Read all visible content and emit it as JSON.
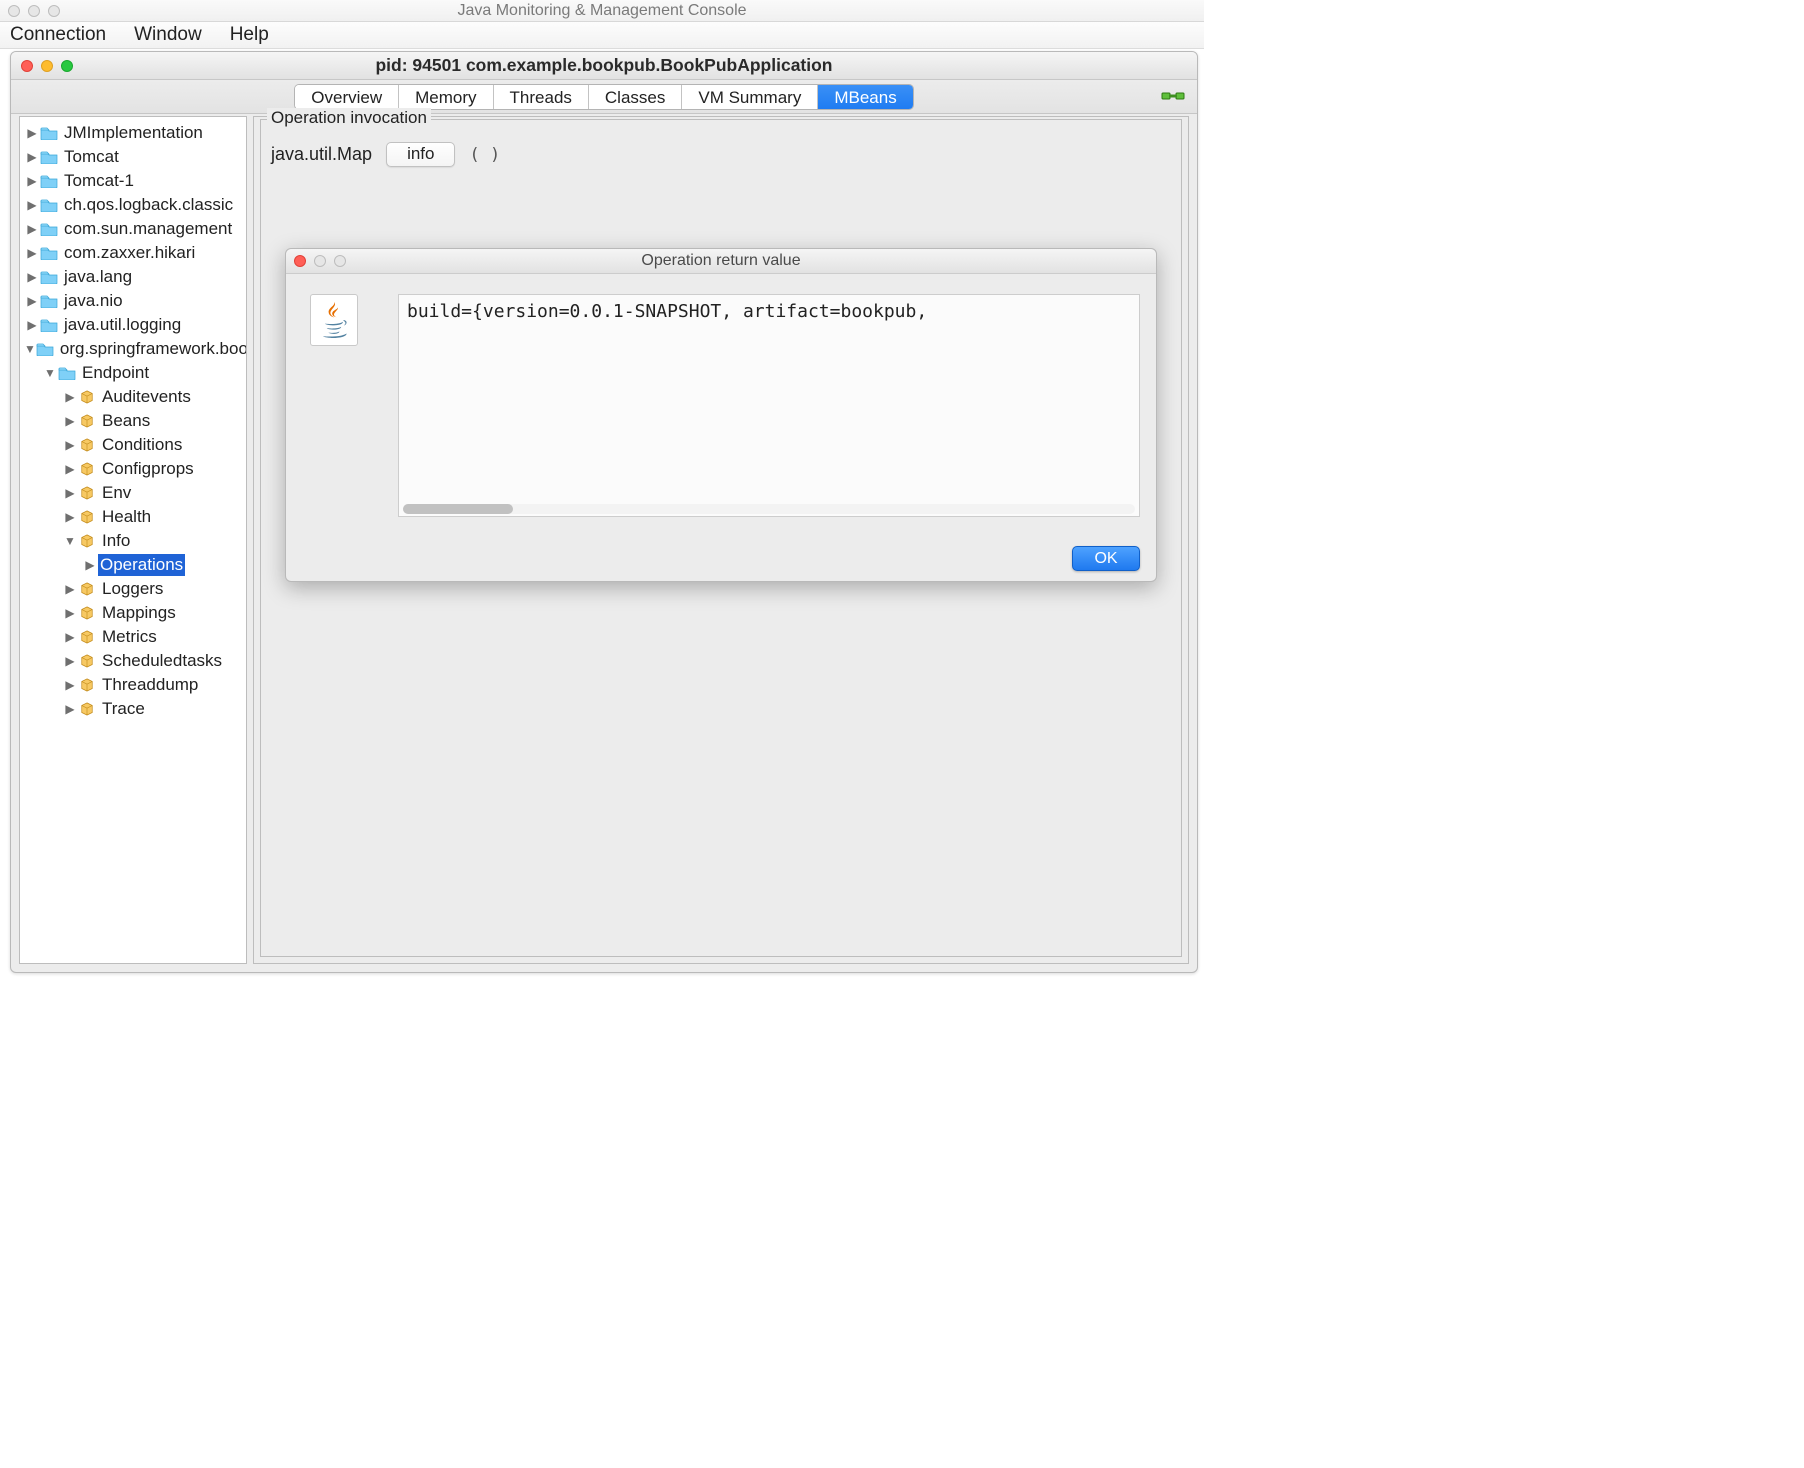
{
  "outer_window": {
    "title": "Java Monitoring & Management Console"
  },
  "menubar": {
    "items": [
      "Connection",
      "Window",
      "Help"
    ]
  },
  "doc_window": {
    "title": "pid: 94501 com.example.bookpub.BookPubApplication"
  },
  "tabs": {
    "items": [
      "Overview",
      "Memory",
      "Threads",
      "Classes",
      "VM Summary",
      "MBeans"
    ],
    "active_index": 5
  },
  "tree": {
    "roots": [
      {
        "label": "JMImplementation"
      },
      {
        "label": "Tomcat"
      },
      {
        "label": "Tomcat-1"
      },
      {
        "label": "ch.qos.logback.classic"
      },
      {
        "label": "com.sun.management"
      },
      {
        "label": "com.zaxxer.hikari"
      },
      {
        "label": "java.lang"
      },
      {
        "label": "java.nio"
      },
      {
        "label": "java.util.logging"
      }
    ],
    "expanded": {
      "label": "org.springframework.boot",
      "child": {
        "label": "Endpoint",
        "beans": [
          {
            "label": "Auditevents"
          },
          {
            "label": "Beans"
          },
          {
            "label": "Conditions"
          },
          {
            "label": "Configprops"
          },
          {
            "label": "Env"
          },
          {
            "label": "Health"
          }
        ],
        "expanded_bean": {
          "label": "Info",
          "child_label": "Operations"
        },
        "beans_after": [
          {
            "label": "Loggers"
          },
          {
            "label": "Mappings"
          },
          {
            "label": "Metrics"
          },
          {
            "label": "Scheduledtasks"
          },
          {
            "label": "Threaddump"
          },
          {
            "label": "Trace"
          }
        ]
      }
    }
  },
  "operation": {
    "panel_title": "Operation invocation",
    "return_type": "java.util.Map",
    "button_label": "info",
    "parens": "(  )"
  },
  "dialog": {
    "title": "Operation return value",
    "result_text": "build={version=0.0.1-SNAPSHOT, artifact=bookpub,",
    "ok_label": "OK"
  }
}
